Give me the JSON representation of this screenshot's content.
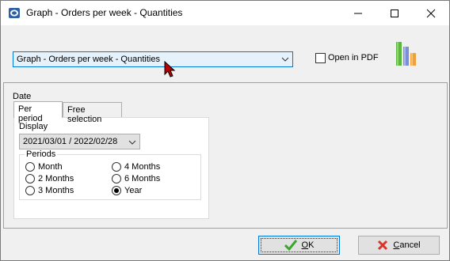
{
  "window": {
    "title": "Graph - Orders per week - Quantities"
  },
  "top": {
    "graph_select_value": "Graph - Orders per week - Quantities",
    "open_pdf_label": "Open in PDF",
    "open_pdf_checked": false
  },
  "main": {
    "date_label": "Date",
    "tabs": [
      {
        "label": "Per period",
        "active": true
      },
      {
        "label": "Free selection",
        "active": false
      }
    ],
    "display_label": "Display",
    "display_value": "2021/03/01 / 2022/02/28",
    "periods_label": "Periods",
    "periods": [
      {
        "label": "Month",
        "checked": false
      },
      {
        "label": "2 Months",
        "checked": false
      },
      {
        "label": "3 Months",
        "checked": false
      },
      {
        "label": "4 Months",
        "checked": false
      },
      {
        "label": "6 Months",
        "checked": false
      },
      {
        "label": "Year",
        "checked": true
      }
    ]
  },
  "buttons": {
    "ok_label_first": "O",
    "ok_label_rest": "K",
    "cancel_label_first": "C",
    "cancel_label_rest": "ancel"
  },
  "icons": {
    "app": "window-app-icon",
    "minimize": "minimize-icon",
    "maximize": "maximize-icon",
    "close": "close-icon",
    "graph": "bar-chart-icon",
    "ok": "green-checkmark-icon",
    "cancel": "red-x-icon"
  }
}
